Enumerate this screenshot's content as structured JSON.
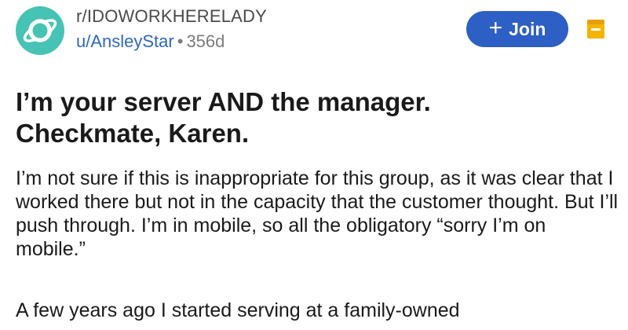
{
  "post": {
    "subreddit": "r/IDOWORKHERELADY",
    "username": "u/AnsleyStar",
    "separator": "•",
    "age": "356d",
    "avatar_icon": "planet-icon",
    "avatar_color": "#46c3b4",
    "join_label": "Join",
    "join_icon": "plus-icon",
    "join_color": "#2d5fc4",
    "save_icon": "bookmark-icon",
    "save_color": "#f5b400",
    "title_line1": "I’m your server AND the manager.",
    "title_line2": "Checkmate, Karen.",
    "body_paragraph_1": "I’m not sure if this is inappropriate for this group, as it was clear that I worked there but not in the capacity that the customer thought. But I’ll push through. I’m in mobile, so all the obligatory “sorry I’m on mobile.”",
    "body_paragraph_2": "A few years ago I started serving at a family-owned"
  }
}
